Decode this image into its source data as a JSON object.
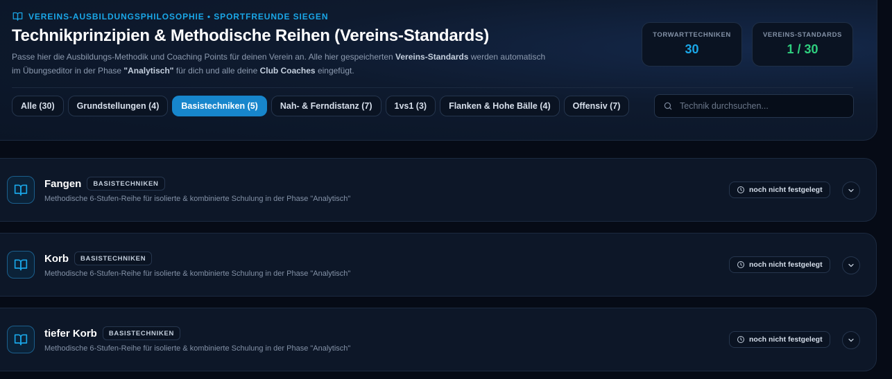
{
  "header": {
    "eyebrow": "VEREINS-AUSBILDUNGSPHILOSOPHIE • SPORTFREUNDE SIEGEN",
    "title": "Technikprinzipien & Methodische Reihen (Vereins-Standards)",
    "description": {
      "part1": "Passe hier die Ausbildungs-Methodik und Coaching Points für deinen Verein an. Alle hier gespeicherten ",
      "bold1": "Vereins-Standards",
      "part2": " werden automatisch im Übungseditor in der Phase ",
      "bold2": "\"Analytisch\"",
      "part3": " für dich und alle deine ",
      "bold3": "Club Coaches",
      "part4": " eingefügt."
    }
  },
  "stats": {
    "techniques_label": "TORWARTTECHNIKEN",
    "techniques_value": "30",
    "standards_label": "VEREINS-STANDARDS",
    "standards_value": "1 / 30"
  },
  "filters": [
    {
      "label": "Alle (30)"
    },
    {
      "label": "Grundstellungen (4)"
    },
    {
      "label": "Basistechniken (5)"
    },
    {
      "label": "Nah- & Ferndistanz (7)"
    },
    {
      "label": "1vs1 (3)"
    },
    {
      "label": "Flanken & Hohe Bälle (4)"
    },
    {
      "label": "Offensiv (7)"
    }
  ],
  "active_filter": "Basistechniken (5)",
  "search": {
    "placeholder": "Technik durchsuchen..."
  },
  "techniques": [
    {
      "title": "Fangen",
      "tag": "BASISTECHNIKEN",
      "subtitle": "Methodische 6-Stufen-Reihe für isolierte & kombinierte Schulung in der Phase \"Analytisch\"",
      "status": "noch nicht festgelegt"
    },
    {
      "title": "Korb",
      "tag": "BASISTECHNIKEN",
      "subtitle": "Methodische 6-Stufen-Reihe für isolierte & kombinierte Schulung in der Phase \"Analytisch\"",
      "status": "noch nicht festgelegt"
    },
    {
      "title": "tiefer Korb",
      "tag": "BASISTECHNIKEN",
      "subtitle": "Methodische 6-Stufen-Reihe für isolierte & kombinierte Schulung in der Phase \"Analytisch\"",
      "status": "noch nicht festgelegt"
    }
  ],
  "icons": {
    "eyebrow": "book-open-icon",
    "search": "search-icon",
    "technique": "book-open-icon",
    "status": "clock-icon",
    "expand": "chevron-down-icon"
  },
  "colors": {
    "accent": "#1aa7e8",
    "active_chip": "#1786cc",
    "success": "#2fd07f",
    "background": "#060b16"
  }
}
